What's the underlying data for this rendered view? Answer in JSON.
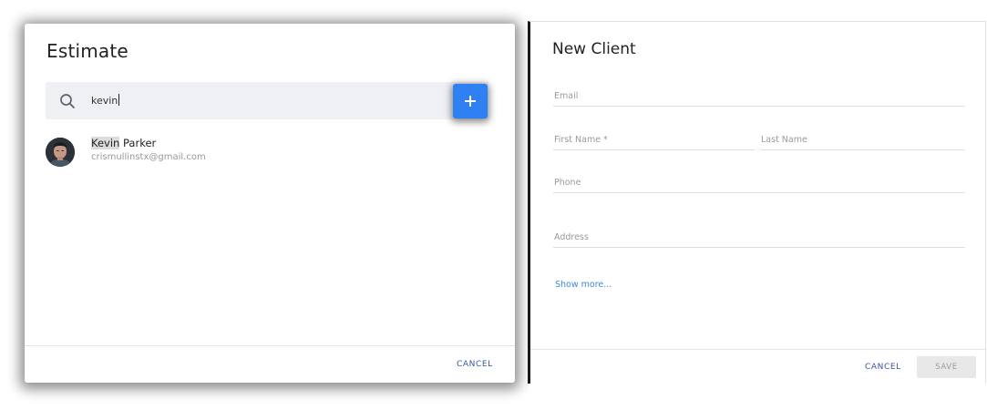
{
  "estimate_dialog": {
    "title": "Estimate",
    "search": {
      "value": "kevin",
      "icon": "search-icon"
    },
    "add_button": {
      "icon": "plus-icon",
      "color": "#2f80f2"
    },
    "results": [
      {
        "name_match": "Kevin",
        "name_rest": " Parker",
        "email": "crismullinstx@gmail.com",
        "avatar": "person-avatar"
      }
    ],
    "cancel_label": "CANCEL"
  },
  "new_client_dialog": {
    "title": "New Client",
    "fields": {
      "email": "Email",
      "first_name": "First Name *",
      "last_name": "Last Name",
      "phone": "Phone",
      "address": "Address"
    },
    "show_more": "Show more...",
    "cancel_label": "CANCEL",
    "save_label": "SAVE"
  }
}
